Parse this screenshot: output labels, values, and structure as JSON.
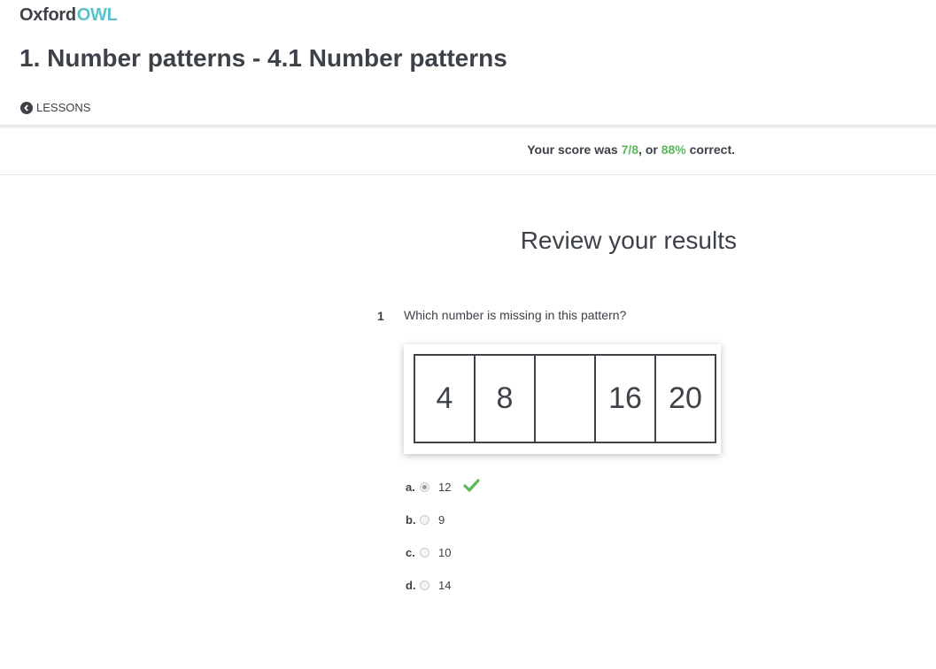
{
  "header": {
    "logo_text_1": "Oxford",
    "logo_text_2": "OWL",
    "title": "1. Number patterns - 4.1 Number patterns",
    "back_label": "LESSONS"
  },
  "score": {
    "prefix": "Your score was ",
    "fraction": "7/8",
    "middle": ", or ",
    "percent": "88%",
    "suffix": " correct."
  },
  "review": {
    "title": "Review your results"
  },
  "question": {
    "number": "1",
    "text": "Which number is missing in this pattern?",
    "pattern": [
      "4",
      "8",
      "",
      "16",
      "20"
    ],
    "options": [
      {
        "letter": "a.",
        "value": "12",
        "selected": true,
        "correct": true
      },
      {
        "letter": "b.",
        "value": "9",
        "selected": false,
        "correct": false
      },
      {
        "letter": "c.",
        "value": "10",
        "selected": false,
        "correct": false
      },
      {
        "letter": "d.",
        "value": "14",
        "selected": false,
        "correct": false
      }
    ]
  },
  "colors": {
    "text": "#3d4148",
    "brand_owl": "#5ac2cc",
    "success": "#5cb85c"
  },
  "icons": {
    "back": "chevron-circle-left-icon",
    "tick": "checkmark-icon"
  }
}
